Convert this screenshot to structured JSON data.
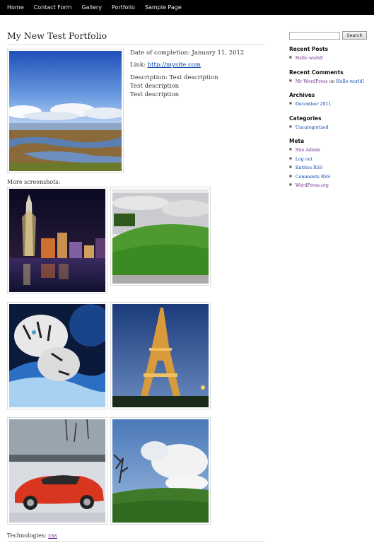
{
  "nav": [
    "Home",
    "Contact Form",
    "Gallery",
    "Portfolio",
    "Sample Page"
  ],
  "page": {
    "title": "My New Test Portfolio",
    "completion": "Date of completion: January 11, 2012",
    "link_label": "Link: ",
    "link_url": "http://mysite.com",
    "description": "Description: Test description",
    "desc_lines": [
      "Test description",
      "Test description"
    ],
    "more_label": "More screenshots:",
    "tech_label": "Technologies: ",
    "tech_value": "css"
  },
  "screenshots": [
    {
      "name": "shanghai-night-skyline"
    },
    {
      "name": "green-hill-landscape"
    },
    {
      "name": "white-tiger-artwork"
    },
    {
      "name": "eiffel-tower-night"
    },
    {
      "name": "red-sports-car"
    },
    {
      "name": "cloudy-sky-hill"
    }
  ],
  "sidebar": {
    "search_placeholder": "",
    "search_button": "Search",
    "recent_posts_title": "Recent Posts",
    "recent_posts": [
      "Hello world!"
    ],
    "recent_comments_title": "Recent Comments",
    "comment_author": "Mr WordPress",
    "comment_on": " on ",
    "comment_post": "Hello world!",
    "archives_title": "Archives",
    "archives": [
      "December 2011"
    ],
    "categories_title": "Categories",
    "categories": [
      "Uncategorized"
    ],
    "meta_title": "Meta",
    "meta": [
      "Site Admin",
      "Log out",
      "Entries RSS",
      "Comments RSS",
      "WordPress.org"
    ]
  }
}
